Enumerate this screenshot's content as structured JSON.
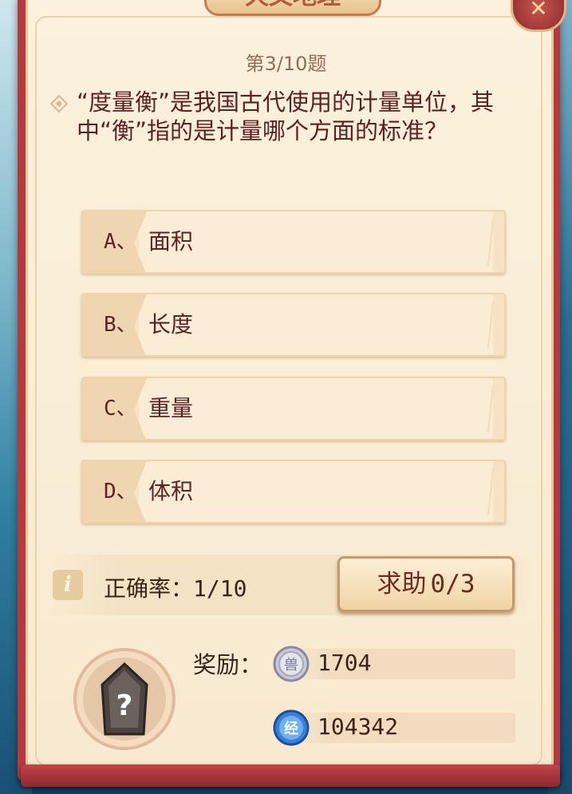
{
  "header": {
    "title": "天文地理",
    "close_icon": "close-icon"
  },
  "quiz": {
    "progress": "第3/10题",
    "question": "“度量衡”是我国古代使用的计量单位，其中“衡”指的是计量哪个方面的标准？",
    "options": [
      {
        "letter": "A、",
        "text": "面积"
      },
      {
        "letter": "B、",
        "text": "长度"
      },
      {
        "letter": "C、",
        "text": "重量"
      },
      {
        "letter": "D、",
        "text": "体积"
      }
    ]
  },
  "status": {
    "accuracy_label": "正确率：",
    "accuracy_value": "1/10",
    "help_label": "求助",
    "help_value": "0/3"
  },
  "reward": {
    "label": "奖励：",
    "items": [
      {
        "icon": "silver-coin-icon",
        "glyph": "兽",
        "value": "1704"
      },
      {
        "icon": "experience-icon",
        "glyph": "经",
        "value": "104342"
      }
    ]
  },
  "colors": {
    "frame_red": "#b43a3e",
    "paper": "#fbf1dc",
    "text_dark": "#5b2324",
    "accent_brown": "#c59a68"
  }
}
